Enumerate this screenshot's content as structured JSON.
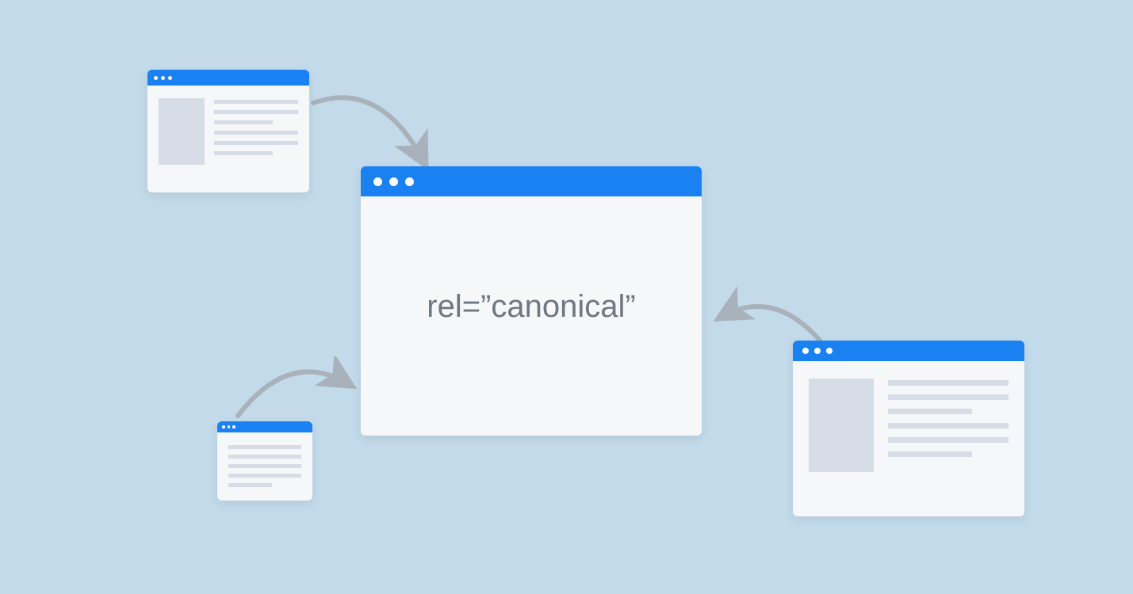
{
  "diagram": {
    "concept": "canonical-url",
    "central_label": "rel=”canonical”",
    "colors": {
      "background": "#c2daea",
      "titlebar": "#1a81f2",
      "window_bg": "#f6f7f8",
      "placeholder": "#d6dde7",
      "arrow": "#a9b2bb",
      "text": "#6f7782"
    },
    "windows": {
      "center": {
        "role": "canonical-page"
      },
      "top_left": {
        "role": "duplicate-page"
      },
      "bottom_left": {
        "role": "duplicate-page"
      },
      "right": {
        "role": "duplicate-page"
      }
    },
    "arrows": [
      {
        "from": "top_left",
        "to": "center"
      },
      {
        "from": "bottom_left",
        "to": "center"
      },
      {
        "from": "right",
        "to": "center"
      }
    ]
  }
}
